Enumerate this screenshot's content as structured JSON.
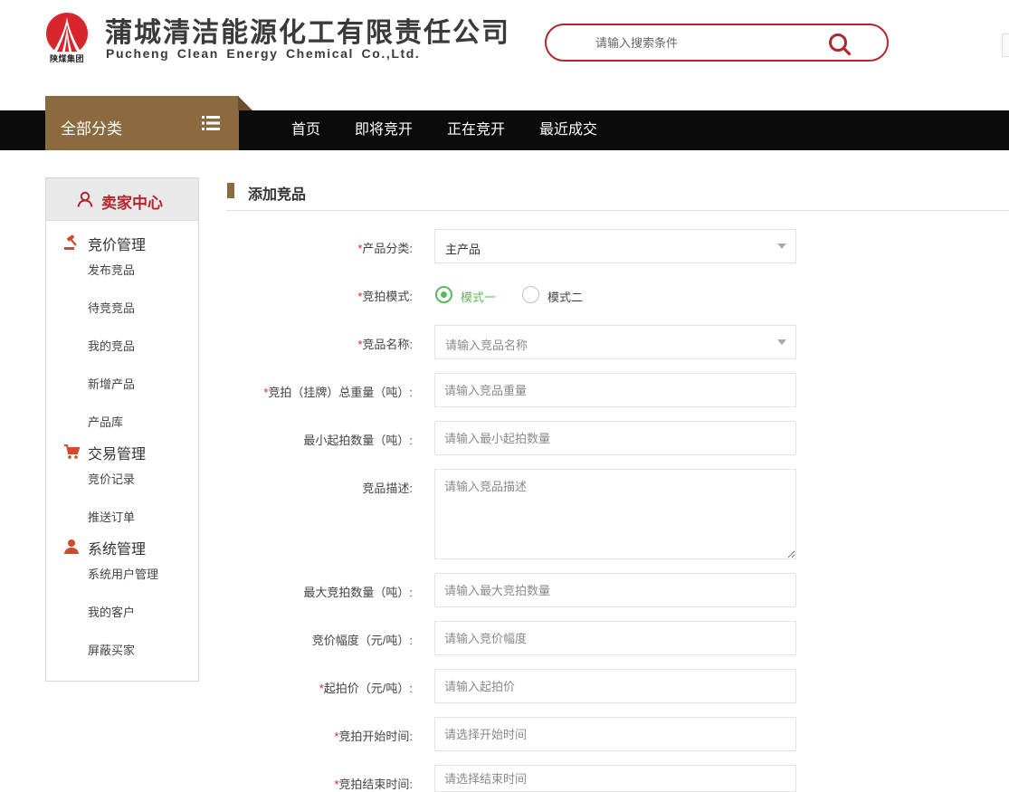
{
  "header": {
    "logo_caption": "陕煤集团",
    "company_cn": "蒲城清洁能源化工有限责任公司",
    "company_en": "Pucheng Clean Energy Chemical Co.,Ltd.",
    "search": {
      "placeholder": "请输入搜索条件"
    }
  },
  "nav": {
    "all_categories": "全部分类",
    "items": [
      {
        "label": "首页"
      },
      {
        "label": "即将竞开"
      },
      {
        "label": "正在竞开"
      },
      {
        "label": "最近成交"
      }
    ]
  },
  "sidebar": {
    "title": "卖家中心",
    "groups": [
      {
        "label": "竞价管理",
        "items": [
          "发布竞品",
          "待竞竞品",
          "我的竞品",
          "新增产品",
          "产品库"
        ]
      },
      {
        "label": "交易管理",
        "items": [
          "竞价记录",
          "推送订单"
        ]
      },
      {
        "label": "系统管理",
        "items": [
          "系统用户管理",
          "我的客户",
          "屏蔽买家"
        ]
      }
    ]
  },
  "main": {
    "title": "添加竞品",
    "required_mark": "*",
    "fields": {
      "category": {
        "label": "产品分类:",
        "value": "主产品"
      },
      "mode": {
        "label": "竞拍模式:",
        "options": [
          "模式一",
          "模式二"
        ],
        "selected": "模式一"
      },
      "name": {
        "label": "竞品名称:",
        "placeholder": "请输入竞品名称"
      },
      "total_weight": {
        "label": "竞拍（挂牌）总重量（吨）:",
        "placeholder": "请输入竞品重量"
      },
      "min_qty": {
        "label": "最小起拍数量（吨）:",
        "placeholder": "请输入最小起拍数量"
      },
      "description": {
        "label": "竞品描述:",
        "placeholder": "请输入竞品描述"
      },
      "max_qty": {
        "label": "最大竞拍数量（吨）:",
        "placeholder": "请输入最大竞拍数量"
      },
      "increment": {
        "label": "竞价幅度（元/吨）:",
        "placeholder": "请输入竞价幅度"
      },
      "start_price": {
        "label": "起拍价（元/吨）:",
        "placeholder": "请输入起拍价"
      },
      "start_time": {
        "label": "竞拍开始时间:",
        "placeholder": "请选择开始时间"
      },
      "end_time": {
        "label": "竞拍结束时间:",
        "placeholder": "请选择结束时间"
      }
    }
  },
  "colors": {
    "brand_red": "#b0282e",
    "accent_brown": "#8c6a3f",
    "nav_bg": "#0b0b0b",
    "radio_green": "#5cb85c"
  }
}
